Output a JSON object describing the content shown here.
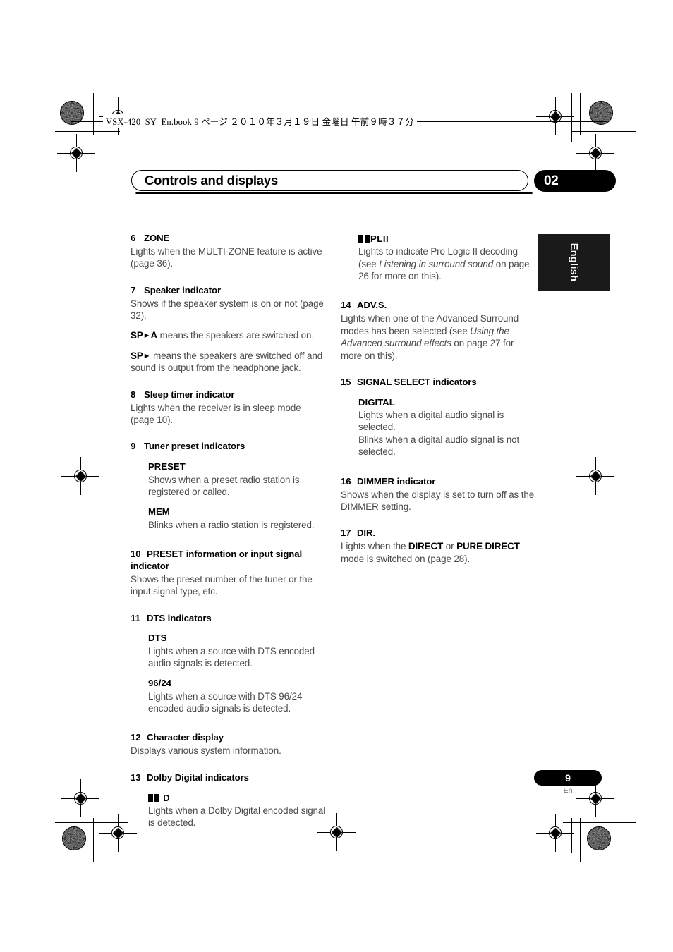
{
  "print_header": {
    "book_line": "VSX-420_SY_En.book   9 ページ   ２０１０年３月１９日   金曜日   午前９時３７分"
  },
  "chapter": {
    "title": "Controls and displays",
    "number": "02"
  },
  "language_tab": {
    "label": "English"
  },
  "footer": {
    "page_number": "9",
    "page_suffix": "En"
  },
  "left_column": {
    "items": [
      {
        "num": "6",
        "title": "ZONE",
        "body": "Lights when the MULTI-ZONE feature is active (page 36)."
      },
      {
        "num": "7",
        "title": "Speaker indicator",
        "body": "Shows if the speaker system is on or not (page 32).",
        "note_1_bold": "SP",
        "note_1_bold_tail": "A",
        "note_1_rest": " means the speakers are switched on.",
        "note_2_bold": "SP",
        "note_2_rest": " means the speakers are switched off and sound is output from the headphone jack."
      },
      {
        "num": "8",
        "title": "Sleep timer indicator",
        "body": "Lights when the receiver is in sleep mode (page 10)."
      },
      {
        "num": "9",
        "title": "Tuner preset indicators",
        "sub": [
          {
            "label": "PRESET",
            "body": "Shows when a preset radio station is registered or called."
          },
          {
            "label": "MEM",
            "body": "Blinks when a radio station is registered."
          }
        ]
      },
      {
        "num": "10",
        "title": "PRESET information or input signal indicator",
        "body": "Shows the preset number of the tuner or the input signal type, etc."
      },
      {
        "num": "11",
        "title": "DTS indicators",
        "sub": [
          {
            "label": "DTS",
            "body": "Lights when a source with DTS encoded audio signals is detected."
          },
          {
            "label": "96/24",
            "body": "Lights when a source with DTS 96/24 encoded audio signals is detected."
          }
        ]
      },
      {
        "num": "12",
        "title": "Character display",
        "body": "Displays various system information."
      },
      {
        "num": "13",
        "title": "Dolby Digital indicators",
        "sub": [
          {
            "label": "D",
            "label_has_dolby_glyph": true,
            "body": "Lights when a Dolby Digital encoded signal is detected."
          }
        ]
      }
    ]
  },
  "right_column": {
    "pl2": {
      "label": "PLII",
      "label_has_dolby_glyph": true,
      "body_part_1": "Lights to indicate Pro Logic II decoding (see ",
      "body_italic": "Listening in surround sound",
      "body_part_2": " on page 26 for more on this)."
    },
    "items": [
      {
        "num": "14",
        "title": "ADV.S.",
        "body_part_1": "Lights when one of the Advanced Surround modes has been selected (see ",
        "body_italic": "Using the Advanced surround effects",
        "body_part_2": " on page 27 for more on this)."
      },
      {
        "num": "15",
        "title": "SIGNAL SELECT indicators",
        "sub": [
          {
            "label": "DIGITAL",
            "body": "Lights when a digital audio signal is selected.",
            "body_2": "Blinks when a digital audio signal is not selected."
          }
        ]
      },
      {
        "num": "16",
        "title": "DIMMER indicator",
        "body": "Shows when the display is set to turn off as the DIMMER setting."
      },
      {
        "num": "17",
        "title": "DIR.",
        "body_part_1": "Lights when the ",
        "body_bold_1": "DIRECT",
        "body_part_2": " or ",
        "body_bold_2": "PURE DIRECT",
        "body_part_3": " mode is switched on (page 28)."
      }
    ]
  }
}
